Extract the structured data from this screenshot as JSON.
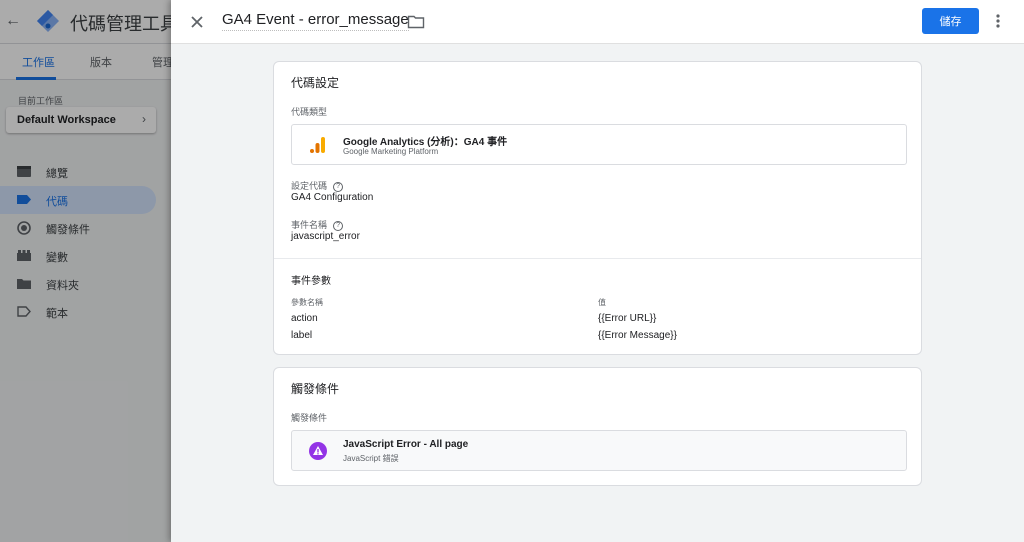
{
  "background": {
    "product_name": "代碼管理工具",
    "tabs": [
      {
        "label": "工作區",
        "active": true
      },
      {
        "label": "版本",
        "active": false
      },
      {
        "label": "管理",
        "active": false
      }
    ],
    "workspace": {
      "label": "目前工作區",
      "name": "Default Workspace"
    },
    "nav": [
      {
        "label": "總覽",
        "icon": "overview-icon",
        "active": false
      },
      {
        "label": "代碼",
        "icon": "tag-icon",
        "active": true
      },
      {
        "label": "觸發條件",
        "icon": "trigger-icon",
        "active": false
      },
      {
        "label": "變數",
        "icon": "variables-icon",
        "active": false
      },
      {
        "label": "資料夾",
        "icon": "folder-icon",
        "active": false
      },
      {
        "label": "範本",
        "icon": "templates-icon",
        "active": false
      }
    ]
  },
  "panel": {
    "title": "GA4 Event - error_message",
    "save_label": "儲存",
    "config": {
      "title": "代碼設定",
      "type_label": "代碼類型",
      "type_name": "Google Analytics (分析)：GA4 事件",
      "type_sub": "Google Marketing Platform",
      "config_tag_label": "設定代碼",
      "config_tag_value": "GA4 Configuration",
      "event_name_label": "事件名稱",
      "event_name_value": "javascript_error",
      "params_title": "事件參數",
      "param_name_header": "參數名稱",
      "param_value_header": "值",
      "params": [
        {
          "name": "action",
          "value": "{{Error URL}}"
        },
        {
          "name": "label",
          "value": "{{Error Message}}"
        }
      ]
    },
    "triggering": {
      "title": "觸發條件",
      "label": "觸發條件",
      "trigger_name": "JavaScript Error - All page",
      "trigger_sub": "JavaScript 錯誤"
    }
  },
  "colors": {
    "accent": "#1a73e8",
    "ga_orange": "#f9ab00",
    "ga_dark_orange": "#e37400",
    "trigger_purple": "#9334e6"
  }
}
